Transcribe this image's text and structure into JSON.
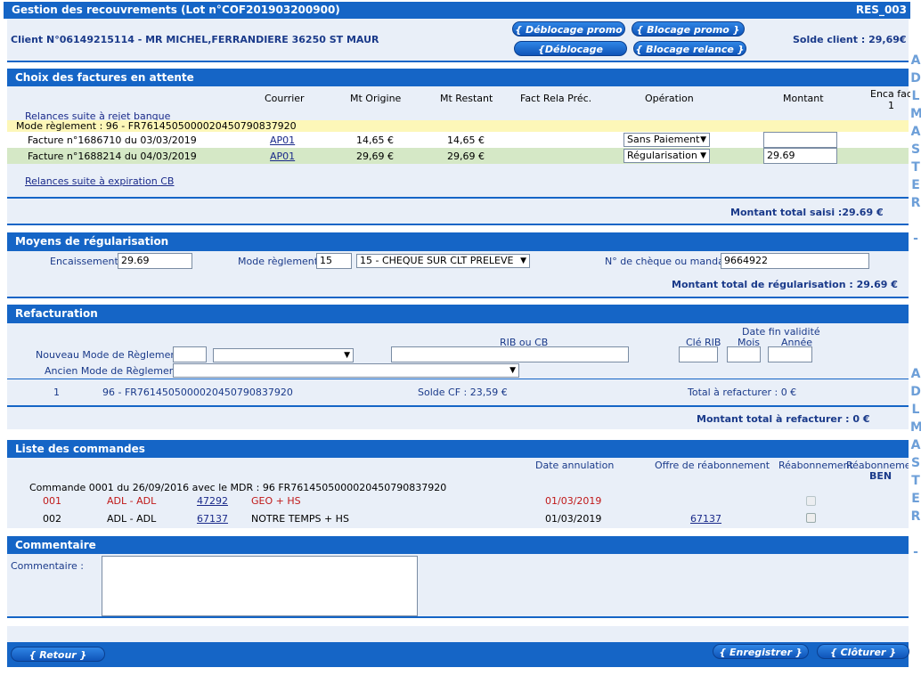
{
  "header": {
    "title": "Gestion des recouvrements (Lot n°COF201903200900)",
    "screen_code": "RES_003"
  },
  "client": {
    "line": "Client N°06149215114 - MR MICHEL,FERRANDIERE 36250 ST MAUR",
    "solde": "Solde client : 29,69€"
  },
  "promo_buttons": {
    "deblocage_promo": "{ Déblocage promo }",
    "blocage_promo": "{ Blocage promo }",
    "deblocage_relance": "{Déblocage relance}",
    "blocage_relance": "{ Blocage relance }"
  },
  "factures": {
    "section_title": "Choix des factures en attente",
    "columns": {
      "courrier": "Courrier",
      "mt_origine": "Mt Origine",
      "mt_restant": "Mt Restant",
      "fact_rela": "Fact Rela Préc.",
      "operation": "Opération",
      "montant": "Montant",
      "enca_fact": "Enca fact",
      "enca_fact_n": "1"
    },
    "relances_rejet": "Relances suite à rejet banque",
    "mode_reglement": "Mode règlement : 96 - FR7614505000020450790837920",
    "rows": [
      {
        "label": "Facture n°1686710 du 03/03/2019",
        "courrier": "AP01",
        "mt_origine": "14,65 €",
        "mt_restant": "14,65 €",
        "operation": "Sans Paiement",
        "montant": ""
      },
      {
        "label": "Facture n°1688214 du 04/03/2019",
        "courrier": "AP01",
        "mt_origine": "29,69 €",
        "mt_restant": "29,69 €",
        "operation": "Régularisation",
        "montant": "29.69"
      }
    ],
    "relances_cb": "Relances suite à expiration CB",
    "total_saisi": "Montant total saisi :29.69 €"
  },
  "moyens": {
    "section_title": "Moyens de régularisation",
    "encaissement_label": "Encaissement :",
    "encaissement": "29.69",
    "mode_label": "Mode règlement :",
    "mode_code": "15",
    "mode_select": "15 - CHEQUE SUR CLT PRELEVE",
    "cheque_label": "N° de chèque ou mandat :",
    "cheque": "9664922",
    "total": "Montant total de régularisation : 29.69 €"
  },
  "refacturation": {
    "section_title": "Refacturation",
    "date_fin": "Date fin validité",
    "rib_cb": "RIB ou CB",
    "cle_rib": "Clé RIB",
    "mois": "Mois",
    "annee": "Année",
    "nouveau_label": "Nouveau Mode de Règlement :",
    "ancien_label": "Ancien Mode de Règlement :",
    "row": {
      "num": "1",
      "mode": "96 - FR7614505000020450790837920",
      "solde": "Solde CF : 23,59 €",
      "total": "Total à refacturer : 0 €"
    },
    "total": "Montant total à refacturer : 0 €"
  },
  "commandes": {
    "section_title": "Liste des commandes",
    "columns": {
      "date_annulation": "Date annulation",
      "offre": "Offre de réabonnement",
      "reabonnement": "Réabonnement",
      "reabonnement_ben": "Réabonnement",
      "ben": "BEN"
    },
    "commande_line": "Commande 0001 du 26/09/2016 avec le MDR : 96 FR7614505000020450790837920",
    "rows": [
      {
        "num": "001",
        "type": "ADL - ADL",
        "code": "47292",
        "titre": "GEO + HS",
        "date": "01/03/2019",
        "offre": "",
        "cancelled": true
      },
      {
        "num": "002",
        "type": "ADL - ADL",
        "code": "67137",
        "titre": "NOTRE TEMPS + HS",
        "date": "01/03/2019",
        "offre": "67137",
        "cancelled": false
      }
    ]
  },
  "commentaire": {
    "section_title": "Commentaire",
    "label": "Commentaire :",
    "value": ""
  },
  "footer": {
    "retour": "{ Retour }",
    "enregistrer": "{ Enregistrer }",
    "cloturer": "{ Clôturer }"
  },
  "side_letters": [
    "A",
    "D",
    "L",
    "M",
    "A",
    "S",
    "T",
    "E",
    "R",
    "-"
  ],
  "colors": {
    "accent": "#1565c6",
    "panel": "#e9eff8",
    "highlight": "#fdf7b8",
    "row_selected": "#d5e8c6",
    "cancelled": "#c01818"
  }
}
